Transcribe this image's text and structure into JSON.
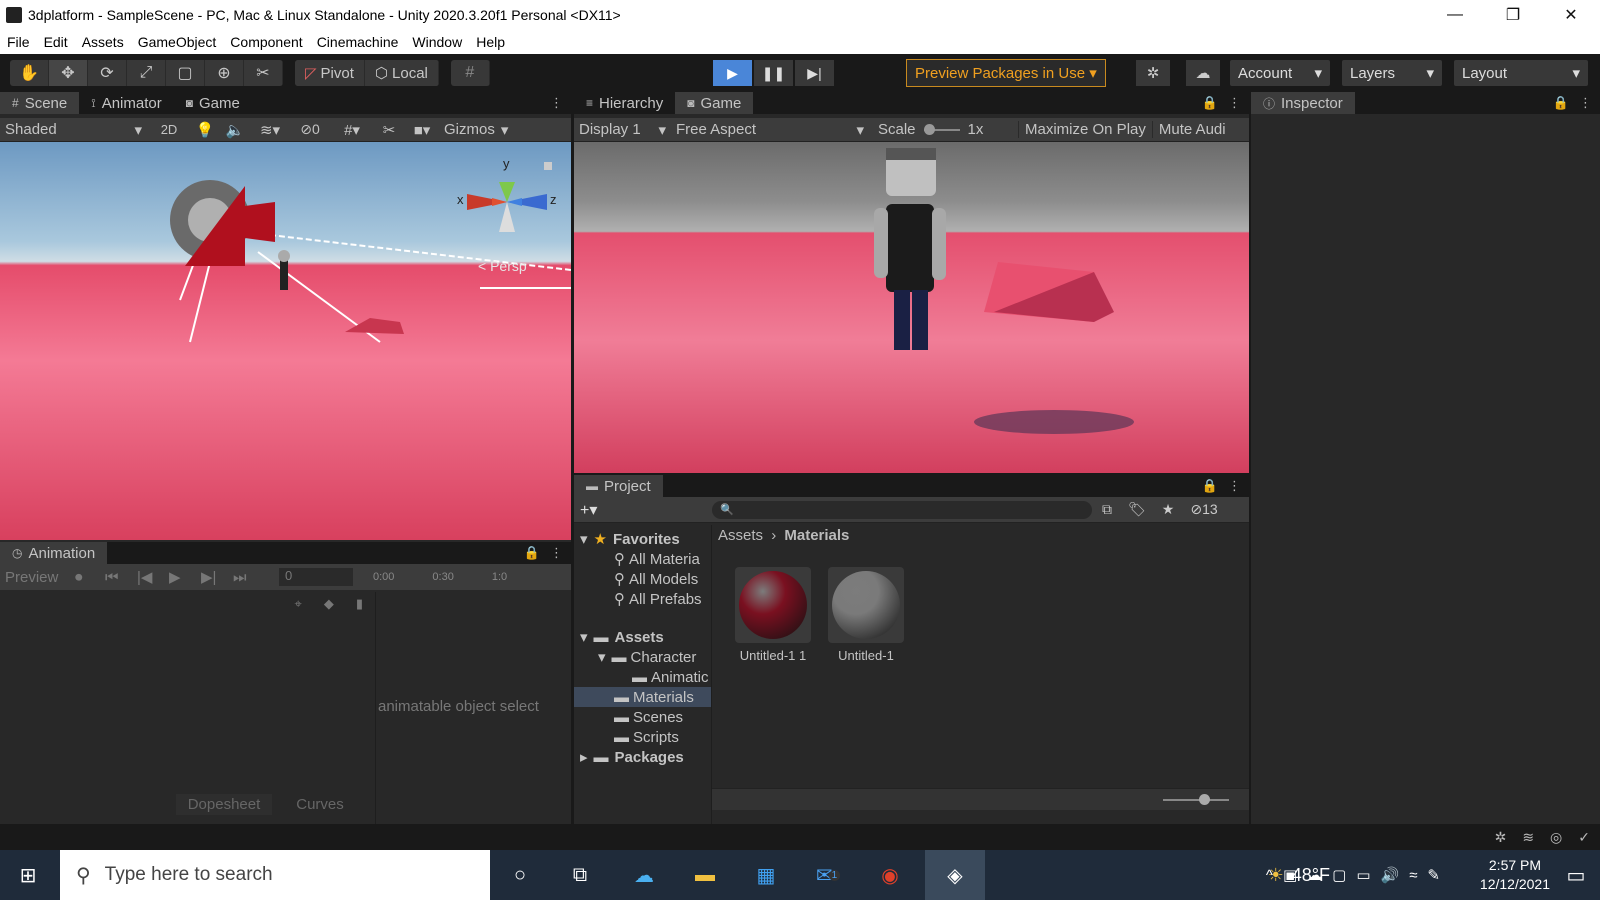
{
  "window": {
    "title": "3dplatform - SampleScene - PC, Mac & Linux Standalone - Unity 2020.3.20f1 Personal <DX11>"
  },
  "menu": [
    "File",
    "Edit",
    "Assets",
    "GameObject",
    "Component",
    "Cinemachine",
    "Window",
    "Help"
  ],
  "toolbar": {
    "pivot": "Pivot",
    "local": "Local",
    "preview_packages": "Preview Packages in Use ▾",
    "account": "Account",
    "layers": "Layers",
    "layout": "Layout"
  },
  "scene_panel": {
    "tabs": [
      "Scene",
      "Animator",
      "Game"
    ],
    "shading": "Shaded",
    "mode_2d": "2D",
    "hidden_count": "0",
    "gizmos": "Gizmos",
    "persp": "< Persp",
    "axes": {
      "x": "x",
      "y": "y",
      "z": "z"
    }
  },
  "game_panel": {
    "tabs": [
      "Hierarchy",
      "Game"
    ],
    "display": "Display 1",
    "aspect": "Free Aspect",
    "scale_label": "Scale",
    "scale_value": "1x",
    "maximize": "Maximize On Play",
    "mute": "Mute Audi"
  },
  "inspector": {
    "tab": "Inspector"
  },
  "animation": {
    "tab": "Animation",
    "preview": "Preview",
    "frame": "0",
    "ticks": [
      "0:00",
      "0:30",
      "1:0"
    ],
    "message": "animatable object select",
    "bottom_tabs": [
      "Dopesheet",
      "Curves"
    ]
  },
  "project": {
    "tab": "Project",
    "hidden_count": "13",
    "breadcrumb": [
      "Assets",
      "Materials"
    ],
    "favorites_label": "Favorites",
    "favorites": [
      "All Materia",
      "All Models",
      "All Prefabs"
    ],
    "assets_label": "Assets",
    "tree": [
      "Character",
      "Animatic",
      "Materials",
      "Scenes",
      "Scripts"
    ],
    "packages_label": "Packages",
    "items": [
      {
        "name": "Untitled-1 1",
        "color": "#7a1020"
      },
      {
        "name": "Untitled-1",
        "color": "#7a7a7a"
      }
    ]
  },
  "taskbar": {
    "search_placeholder": "Type here to search",
    "weather": "48°F",
    "time": "2:57 PM",
    "date": "12/12/2021",
    "mail_badge": "1"
  }
}
